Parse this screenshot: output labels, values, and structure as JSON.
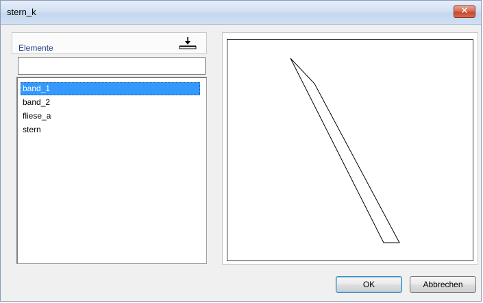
{
  "window": {
    "title": "stern_k",
    "close_icon": "close-icon"
  },
  "elements_panel": {
    "header_label": "Elemente",
    "sort_icon": "sort-down-icon",
    "filter_value": "",
    "items": [
      {
        "label": "band_1",
        "selected": true
      },
      {
        "label": "band_2",
        "selected": false
      },
      {
        "label": "fliese_a",
        "selected": false
      },
      {
        "label": "stern",
        "selected": false
      }
    ]
  },
  "buttons": {
    "ok_label": "OK",
    "cancel_label": "Abbrechen"
  },
  "colors": {
    "selection": "#3399ff",
    "title_bar": "#d3e1f3",
    "close_button": "#c3482a"
  }
}
